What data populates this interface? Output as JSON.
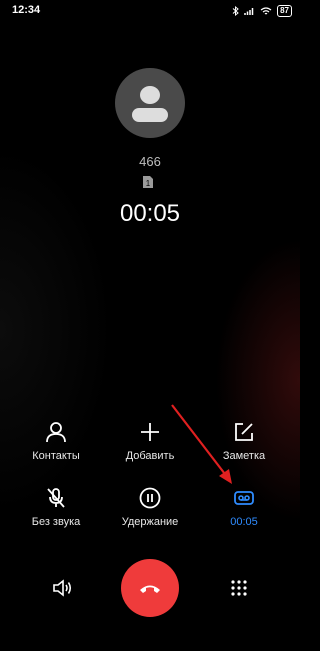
{
  "status_bar": {
    "time": "12:34",
    "battery": "87"
  },
  "contact": {
    "number": "466",
    "sim_slot": "1"
  },
  "call": {
    "duration": "00:05"
  },
  "controls": {
    "row1": [
      {
        "label": "Контакты",
        "icon": "contacts-icon"
      },
      {
        "label": "Добавить",
        "icon": "add-icon"
      },
      {
        "label": "Заметка",
        "icon": "note-icon"
      }
    ],
    "row2": [
      {
        "label": "Без звука",
        "icon": "mute-icon"
      },
      {
        "label": "Удержание",
        "icon": "hold-icon"
      },
      {
        "label": "00:05",
        "icon": "record-icon",
        "active": true
      }
    ]
  },
  "colors": {
    "accent": "#2f8cff",
    "end_call": "#ef3b3b",
    "arrow": "#e02020"
  }
}
